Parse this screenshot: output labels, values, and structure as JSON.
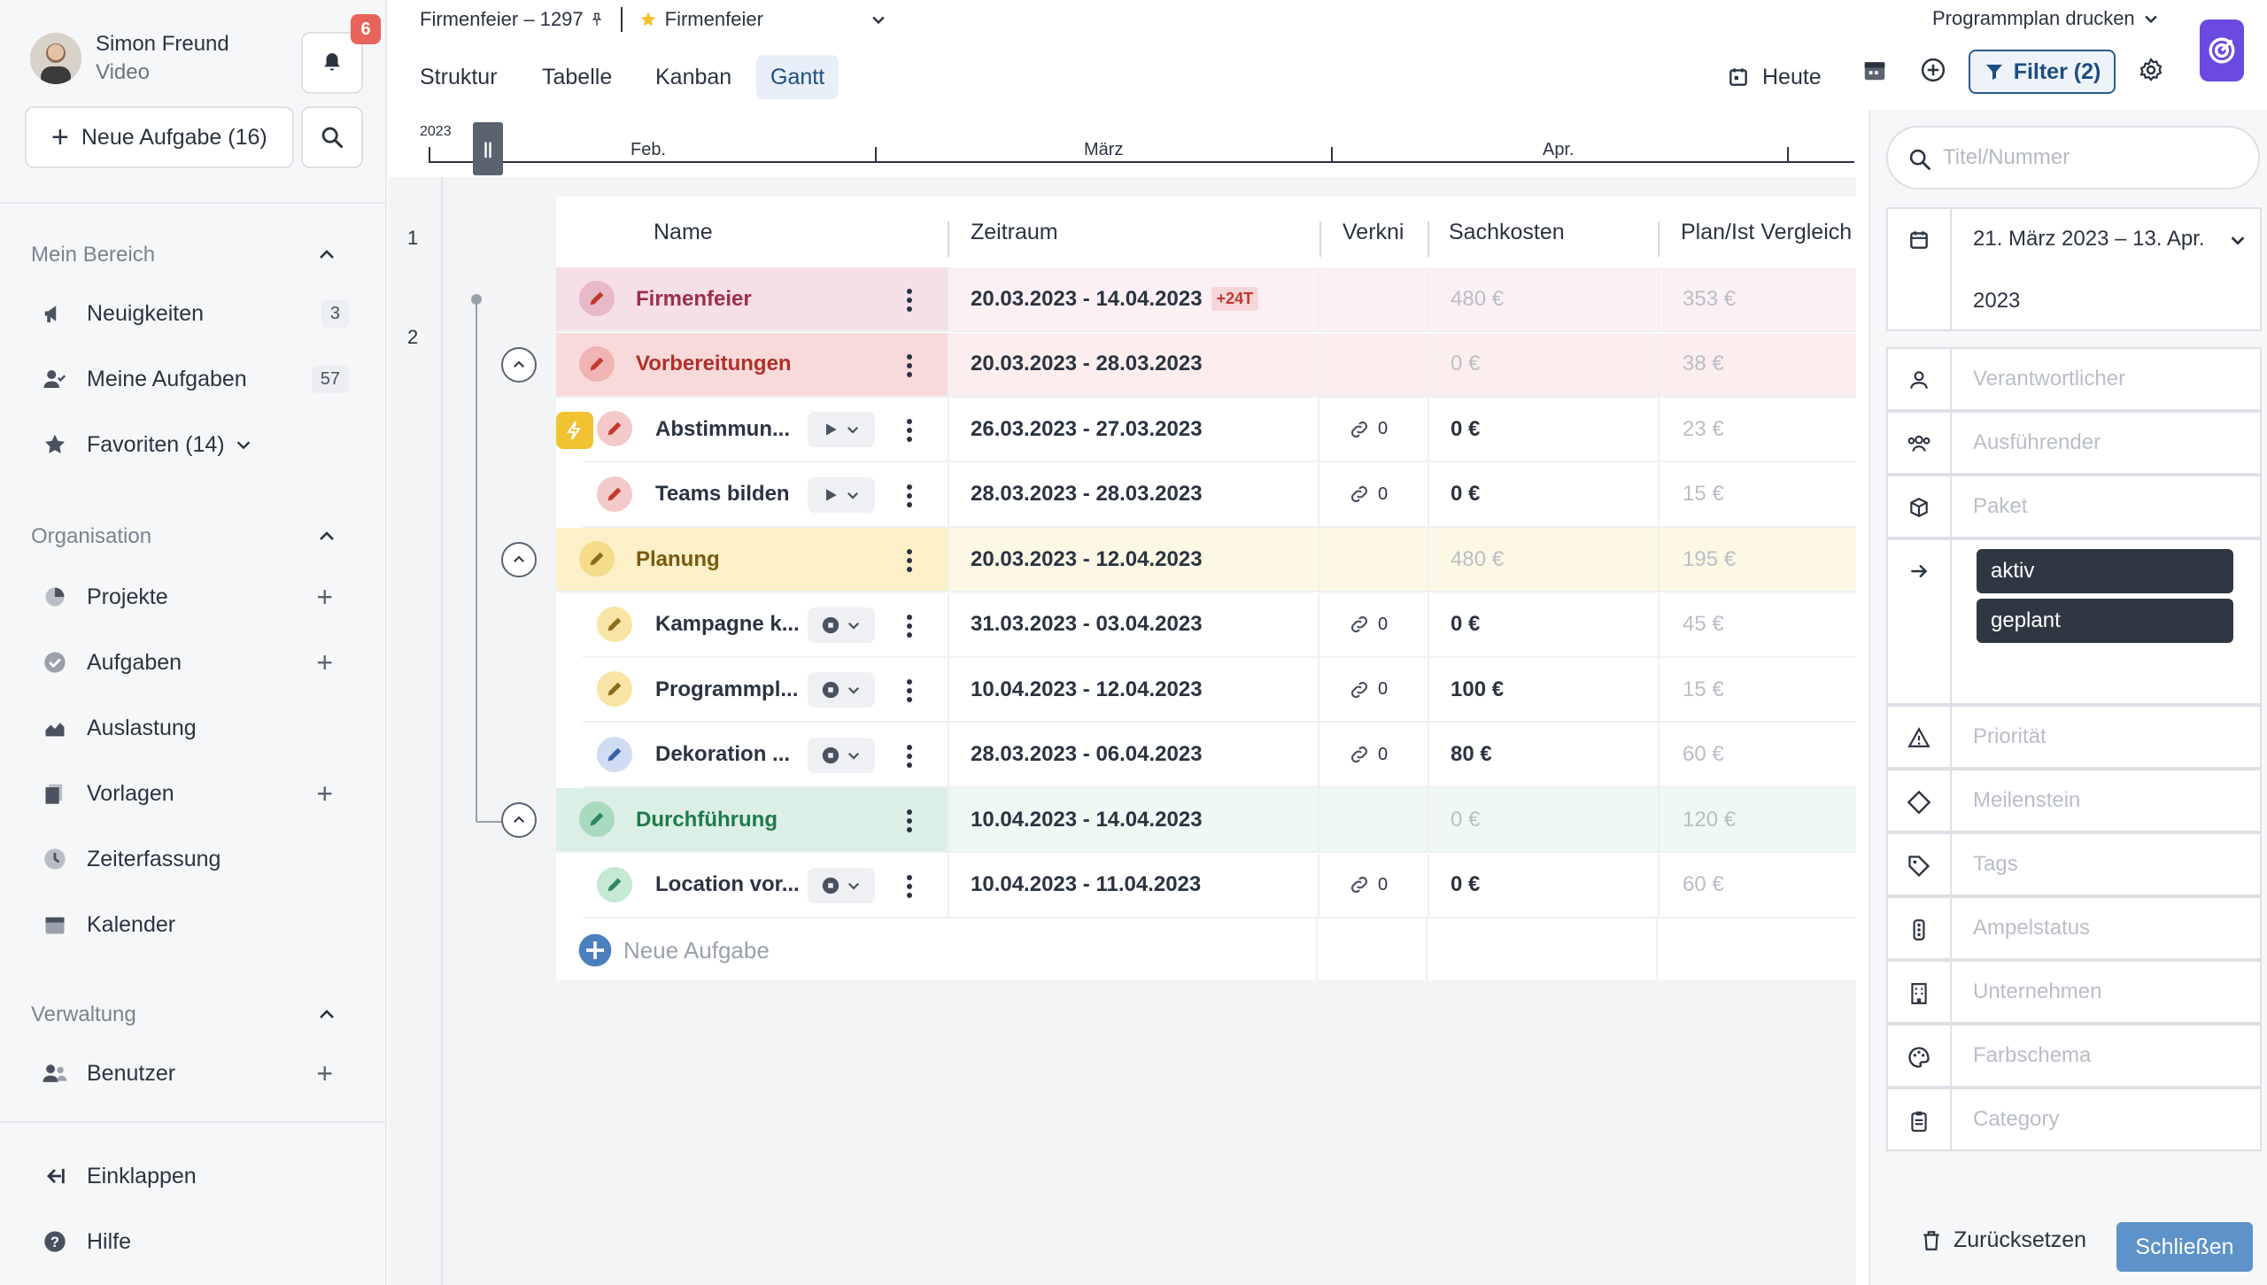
{
  "user": {
    "name": "Simon Freund",
    "role": "Video",
    "notifications": "6"
  },
  "sidebar": {
    "new_task": "Neue Aufgabe (16)",
    "sections": {
      "mein_bereich": "Mein Bereich",
      "organisation": "Organisation",
      "verwaltung": "Verwaltung"
    },
    "mein_bereich_items": [
      {
        "label": "Neuigkeiten",
        "count": "3",
        "icon": "megaphone-icon"
      },
      {
        "label": "Meine Aufgaben",
        "count": "57",
        "icon": "user-check-icon"
      },
      {
        "label": "Favoriten (14)",
        "icon": "star-icon"
      }
    ],
    "organisation_items": [
      {
        "label": "Projekte",
        "icon": "pie-chart-icon"
      },
      {
        "label": "Aufgaben",
        "icon": "check-circle-icon"
      },
      {
        "label": "Auslastung",
        "icon": "area-chart-icon"
      },
      {
        "label": "Vorlagen",
        "icon": "documents-icon"
      },
      {
        "label": "Zeiterfassung",
        "icon": "clock-icon"
      },
      {
        "label": "Kalender",
        "icon": "calendar-icon"
      }
    ],
    "verwaltung_items": [
      {
        "label": "Benutzer",
        "icon": "users-icon"
      }
    ],
    "collapse": "Einklappen",
    "help": "Hilfe"
  },
  "header": {
    "project": "Firmenfeier – 1297",
    "favorite": "Firmenfeier",
    "tabs": [
      "Struktur",
      "Tabelle",
      "Kanban",
      "Gantt"
    ],
    "active_tab": "Gantt",
    "print": "Programmplan drucken",
    "today": "Heute",
    "filter": "Filter (2)"
  },
  "timeline": {
    "year": "2023",
    "months": [
      "Feb.",
      "März",
      "Apr."
    ]
  },
  "row_numbers": [
    "1",
    "2"
  ],
  "table": {
    "columns": [
      "Name",
      "Zeitraum",
      "Verkni",
      "Sachkosten",
      "Plan/Ist Vergleich"
    ],
    "rows": [
      {
        "name": "Firmenfeier",
        "range": "20.03.2023 - 14.04.2023",
        "badge": "+24T",
        "links": "",
        "cost": "480 €",
        "plan": "353 €",
        "level": 0,
        "color": "#f6dfe7"
      },
      {
        "name": "Vorbereitungen",
        "range": "20.03.2023 - 28.03.2023",
        "links": "",
        "cost": "0 €",
        "plan": "38 €",
        "level": 1,
        "color": "#f8dada"
      },
      {
        "name": "Abstimmun...",
        "range": "26.03.2023 - 27.03.2023",
        "links": "0",
        "cost": "0 €",
        "plan": "23 €",
        "level": 2
      },
      {
        "name": "Teams bilden",
        "range": "28.03.2023 - 28.03.2023",
        "links": "0",
        "cost": "0 €",
        "plan": "15 €",
        "level": 2
      },
      {
        "name": "Planung",
        "range": "20.03.2023 - 12.04.2023",
        "links": "",
        "cost": "480 €",
        "plan": "195 €",
        "level": 1,
        "color": "#fbf0c8"
      },
      {
        "name": "Kampagne k...",
        "range": "31.03.2023 - 03.04.2023",
        "links": "0",
        "cost": "0 €",
        "plan": "45 €",
        "level": 2
      },
      {
        "name": "Programmpl...",
        "range": "10.04.2023 - 12.04.2023",
        "links": "0",
        "cost": "100 €",
        "plan": "15 €",
        "level": 2
      },
      {
        "name": "Dekoration ...",
        "range": "28.03.2023 - 06.04.2023",
        "links": "0",
        "cost": "80 €",
        "plan": "60 €",
        "level": 2
      },
      {
        "name": "Durchführung",
        "range": "10.04.2023 - 14.04.2023",
        "links": "",
        "cost": "0 €",
        "plan": "120 €",
        "level": 1,
        "color": "#dcefe6"
      },
      {
        "name": "Location vor...",
        "range": "10.04.2023 - 11.04.2023",
        "links": "0",
        "cost": "0 €",
        "plan": "60 €",
        "level": 2
      }
    ],
    "new_task": "Neue Aufgabe"
  },
  "filter_panel": {
    "search_placeholder": "Titel/Nummer",
    "date_range_line1": "21. März 2023 – 13. Apr.",
    "date_range_line2": "2023",
    "responsible": "Verantwortlicher",
    "executor": "Ausführender",
    "package": "Paket",
    "status_chips": [
      "aktiv",
      "geplant"
    ],
    "priority": "Priorität",
    "milestone": "Meilenstein",
    "tags": "Tags",
    "traffic_light": "Ampelstatus",
    "company": "Unternehmen",
    "color_scheme": "Farbschema",
    "category": "Category",
    "reset": "Zurücksetzen",
    "close": "Schließen"
  },
  "colors": {
    "accent": "#1d4d80",
    "red_pencil": "#c0392b",
    "yellow_pencil": "#8a6d1a",
    "blue_pencil": "#3a5ea8",
    "green_pencil": "#2e8a5b"
  }
}
